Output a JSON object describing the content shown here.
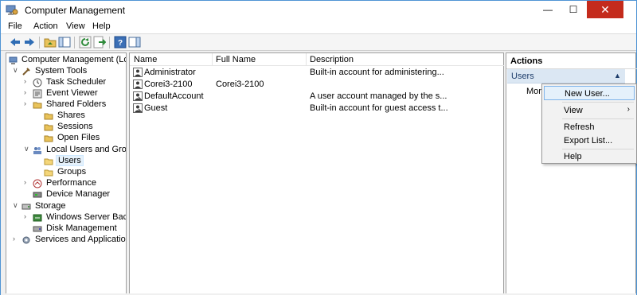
{
  "window": {
    "title": "Computer Management",
    "min_glyph": "—",
    "max_glyph": "☐",
    "close_glyph": "✕"
  },
  "menu": [
    "File",
    "Action",
    "View",
    "Help"
  ],
  "tree": [
    {
      "label": "Computer Management (Local",
      "chev": "",
      "icon": "computer-management-icon"
    },
    {
      "label": "System Tools",
      "chev": "∨",
      "icon": "tools-icon"
    },
    {
      "label": "Task Scheduler",
      "chev": "›",
      "icon": "clock-icon"
    },
    {
      "label": "Event Viewer",
      "chev": "›",
      "icon": "event-viewer-icon"
    },
    {
      "label": "Shared Folders",
      "chev": "›",
      "icon": "shared-folder-icon"
    },
    {
      "label": "Shares",
      "chev": "",
      "icon": "shared-folder-icon"
    },
    {
      "label": "Sessions",
      "chev": "",
      "icon": "shared-folder-icon"
    },
    {
      "label": "Open Files",
      "chev": "",
      "icon": "shared-folder-icon"
    },
    {
      "label": "Local Users and Groups",
      "chev": "∨",
      "icon": "users-group-icon"
    },
    {
      "label": "Users",
      "chev": "",
      "icon": "folder-icon"
    },
    {
      "label": "Groups",
      "chev": "",
      "icon": "folder-icon"
    },
    {
      "label": "Performance",
      "chev": "›",
      "icon": "performance-icon"
    },
    {
      "label": "Device Manager",
      "chev": "",
      "icon": "device-manager-icon"
    },
    {
      "label": "Storage",
      "chev": "∨",
      "icon": "storage-icon"
    },
    {
      "label": "Windows Server Backup",
      "chev": "›",
      "icon": "backup-icon"
    },
    {
      "label": "Disk Management",
      "chev": "",
      "icon": "disk-icon"
    },
    {
      "label": "Services and Applications",
      "chev": "›",
      "icon": "services-icon"
    }
  ],
  "list": {
    "columns": [
      "Name",
      "Full Name",
      "Description"
    ],
    "rows": [
      {
        "name": "Administrator",
        "full_name": "",
        "description": "Built-in account for administering..."
      },
      {
        "name": "Corei3-2100",
        "full_name": "Corei3-2100",
        "description": ""
      },
      {
        "name": "DefaultAccount",
        "full_name": "",
        "description": "A user account managed by the s..."
      },
      {
        "name": "Guest",
        "full_name": "",
        "description": "Built-in account for guest access t..."
      }
    ]
  },
  "actions": {
    "title": "Actions",
    "section": "Users",
    "section_arrow": "▲",
    "more": "More"
  },
  "context_menu": {
    "items": [
      "New User...",
      "View",
      "Refresh",
      "Export List...",
      "Help"
    ],
    "submenu_glyph": "›"
  }
}
